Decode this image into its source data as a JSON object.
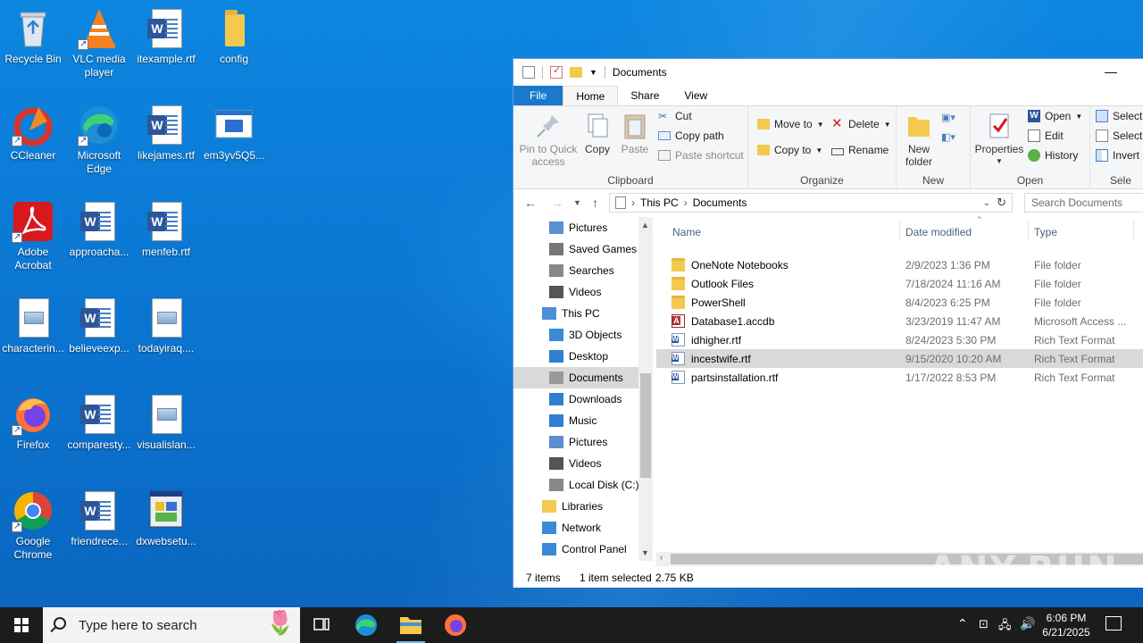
{
  "desktop": {
    "icons": [
      {
        "label": "Recycle Bin"
      },
      {
        "label": "VLC media player"
      },
      {
        "label": "itexample.rtf"
      },
      {
        "label": "config"
      },
      {
        "label": "CCleaner"
      },
      {
        "label": "Microsoft Edge"
      },
      {
        "label": "likejames.rtf"
      },
      {
        "label": "em3yv5Q5..."
      },
      {
        "label": "Adobe Acrobat"
      },
      {
        "label": "approacha..."
      },
      {
        "label": "menfeb.rtf"
      },
      {
        "label": "characterin..."
      },
      {
        "label": "believeexp..."
      },
      {
        "label": "todayiraq...."
      },
      {
        "label": "Firefox"
      },
      {
        "label": "comparesty..."
      },
      {
        "label": "visualislan..."
      },
      {
        "label": "Google Chrome"
      },
      {
        "label": "friendrece..."
      },
      {
        "label": "dxwebsetu..."
      }
    ]
  },
  "explorer": {
    "title": "Documents",
    "minimize": "—",
    "tabs": [
      "File",
      "Home",
      "Share",
      "View"
    ],
    "ribbon": {
      "clipboard": {
        "label": "Clipboard",
        "pin": "Pin to Quick access",
        "copy": "Copy",
        "paste": "Paste",
        "cut": "Cut",
        "copy_path": "Copy path",
        "paste_shortcut": "Paste shortcut"
      },
      "organize": {
        "label": "Organize",
        "move_to": "Move to",
        "copy_to": "Copy to",
        "delete": "Delete",
        "rename": "Rename"
      },
      "new": {
        "label": "New",
        "new_folder": "New folder"
      },
      "open": {
        "label": "Open",
        "properties": "Properties",
        "open": "Open",
        "edit": "Edit",
        "history": "History"
      },
      "select": {
        "label": "Sele",
        "select_all": "Select a",
        "select_none": "Select n",
        "invert": "Invert s"
      }
    },
    "address": {
      "this_pc": "This PC",
      "current": "Documents"
    },
    "search_placeholder": "Search Documents",
    "nav": [
      {
        "label": "Pictures",
        "indent": 2
      },
      {
        "label": "Saved Games",
        "indent": 2
      },
      {
        "label": "Searches",
        "indent": 2
      },
      {
        "label": "Videos",
        "indent": 2
      },
      {
        "label": "This PC",
        "indent": 1
      },
      {
        "label": "3D Objects",
        "indent": 2
      },
      {
        "label": "Desktop",
        "indent": 2
      },
      {
        "label": "Documents",
        "indent": 2,
        "selected": true
      },
      {
        "label": "Downloads",
        "indent": 2
      },
      {
        "label": "Music",
        "indent": 2
      },
      {
        "label": "Pictures",
        "indent": 2
      },
      {
        "label": "Videos",
        "indent": 2
      },
      {
        "label": "Local Disk (C:)",
        "indent": 2
      },
      {
        "label": "Libraries",
        "indent": 1
      },
      {
        "label": "Network",
        "indent": 1
      },
      {
        "label": "Control Panel",
        "indent": 1
      }
    ],
    "columns": {
      "name": "Name",
      "date": "Date modified",
      "type": "Type"
    },
    "files": [
      {
        "name": "OneNote Notebooks",
        "date": "2/9/2023 1:36 PM",
        "type": "File folder",
        "kind": "folder"
      },
      {
        "name": "Outlook Files",
        "date": "7/18/2024 11:16 AM",
        "type": "File folder",
        "kind": "folder"
      },
      {
        "name": "PowerShell",
        "date": "8/4/2023 6:25 PM",
        "type": "File folder",
        "kind": "folder"
      },
      {
        "name": "Database1.accdb",
        "date": "3/23/2019 11:47 AM",
        "type": "Microsoft Access ...",
        "kind": "accdb"
      },
      {
        "name": "idhigher.rtf",
        "date": "8/24/2023 5:30 PM",
        "type": "Rich Text Format",
        "kind": "rtf"
      },
      {
        "name": "incestwife.rtf",
        "date": "9/15/2020 10:20 AM",
        "type": "Rich Text Format",
        "kind": "rtf",
        "selected": true
      },
      {
        "name": "partsinstallation.rtf",
        "date": "1/17/2022 8:53 PM",
        "type": "Rich Text Format",
        "kind": "rtf"
      }
    ],
    "status": {
      "items": "7 items",
      "selected": "1 item selected",
      "size": "2.75 KB"
    }
  },
  "watermark": "ANY.RUN",
  "taskbar": {
    "search_placeholder": "Type here to search",
    "time": "6:06 PM",
    "date": "6/21/2025"
  }
}
